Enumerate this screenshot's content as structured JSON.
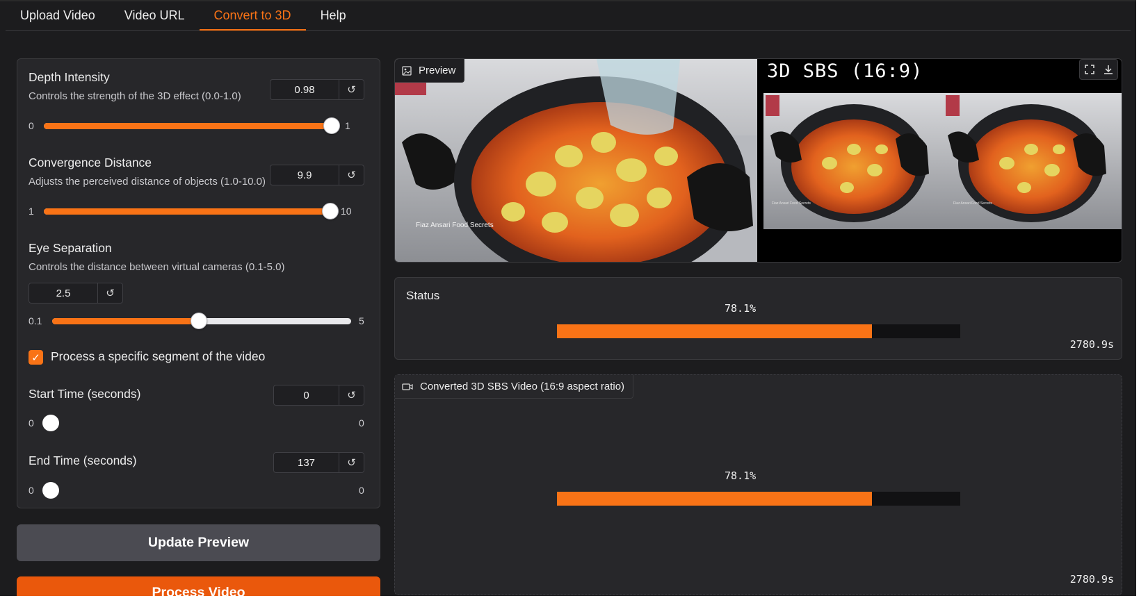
{
  "tabs": [
    "Upload Video",
    "Video URL",
    "Convert to 3D",
    "Help"
  ],
  "active_tab": "Convert to 3D",
  "controls": {
    "depth": {
      "label": "Depth Intensity",
      "info": "Controls the strength of the 3D effect (0.0-1.0)",
      "value": "0.98",
      "min": "0",
      "max": "1",
      "fraction": 0.98
    },
    "convergence": {
      "label": "Convergence Distance",
      "info": "Adjusts the perceived distance of objects (1.0-10.0)",
      "value": "9.9",
      "min": "1",
      "max": "10",
      "fraction": 0.99
    },
    "eye": {
      "label": "Eye Separation",
      "info": "Controls the distance between virtual cameras (0.1-5.0)",
      "value": "2.5",
      "min": "0.1",
      "max": "5",
      "fraction": 0.49
    },
    "segment_checkbox": {
      "label": "Process a specific segment of the video",
      "checked": true
    },
    "start_time": {
      "label": "Start Time (seconds)",
      "value": "0",
      "min": "0",
      "max": "0"
    },
    "end_time": {
      "label": "End Time (seconds)",
      "value": "137",
      "min": "0",
      "max": "0"
    },
    "reset_glyph": "↺"
  },
  "buttons": {
    "update": "Update Preview",
    "process": "Process Video"
  },
  "preview": {
    "label": "Preview",
    "sbs_title": "3D SBS (16:9)",
    "watermark": "Fiaz Ansari Food Secrets",
    "small_watermark": "Fiaz Ansari Food Secrets"
  },
  "status": {
    "label": "Status",
    "percent": "78.1%",
    "fraction": 0.781,
    "elapsed": "2780.9s"
  },
  "video": {
    "label": "Converted 3D SBS Video (16:9 aspect ratio)",
    "percent": "78.1%",
    "fraction": 0.781,
    "elapsed": "2780.9s"
  },
  "colors": {
    "accent": "#f97316",
    "panel": "#27272a",
    "background": "#1c1c1e"
  }
}
